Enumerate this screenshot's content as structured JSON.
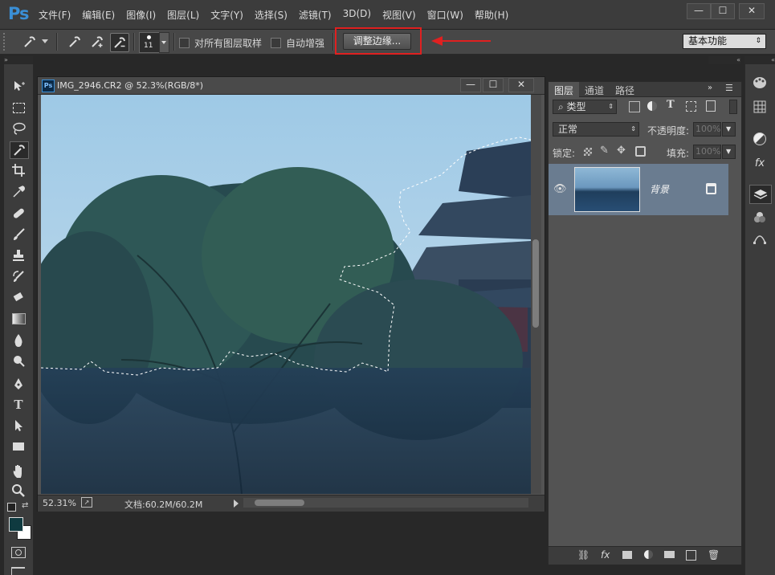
{
  "app": {
    "logo": "Ps"
  },
  "menu": [
    "文件(F)",
    "编辑(E)",
    "图像(I)",
    "图层(L)",
    "文字(Y)",
    "选择(S)",
    "滤镜(T)",
    "3D(D)",
    "视图(V)",
    "窗口(W)",
    "帮助(H)"
  ],
  "window_controls": {
    "minimize": "—",
    "maximize": "☐",
    "close": "✕"
  },
  "options_bar": {
    "brush_size": "11",
    "sample_all_layers": "对所有图层取样",
    "auto_enhance": "自动增强",
    "refine_edge": "调整边缘...",
    "workspace": "基本功能"
  },
  "document": {
    "title": "IMG_2946.CR2 @ 52.3%(RGB/8*)",
    "zoom": "52.31%",
    "doc_size": "文档:60.2M/60.2M"
  },
  "layers_panel": {
    "tabs": [
      "图层",
      "通道",
      "路径"
    ],
    "filter_kind": "类型",
    "blend_mode": "正常",
    "opacity_label": "不透明度:",
    "opacity_value": "100%",
    "lock_label": "锁定:",
    "fill_label": "填充:",
    "fill_value": "100%",
    "layer_name": "背景"
  },
  "colors": {
    "highlight": "#e02020",
    "accent": "#3a8fd6",
    "foreground": "#0f3a40",
    "background": "#ffffff"
  }
}
